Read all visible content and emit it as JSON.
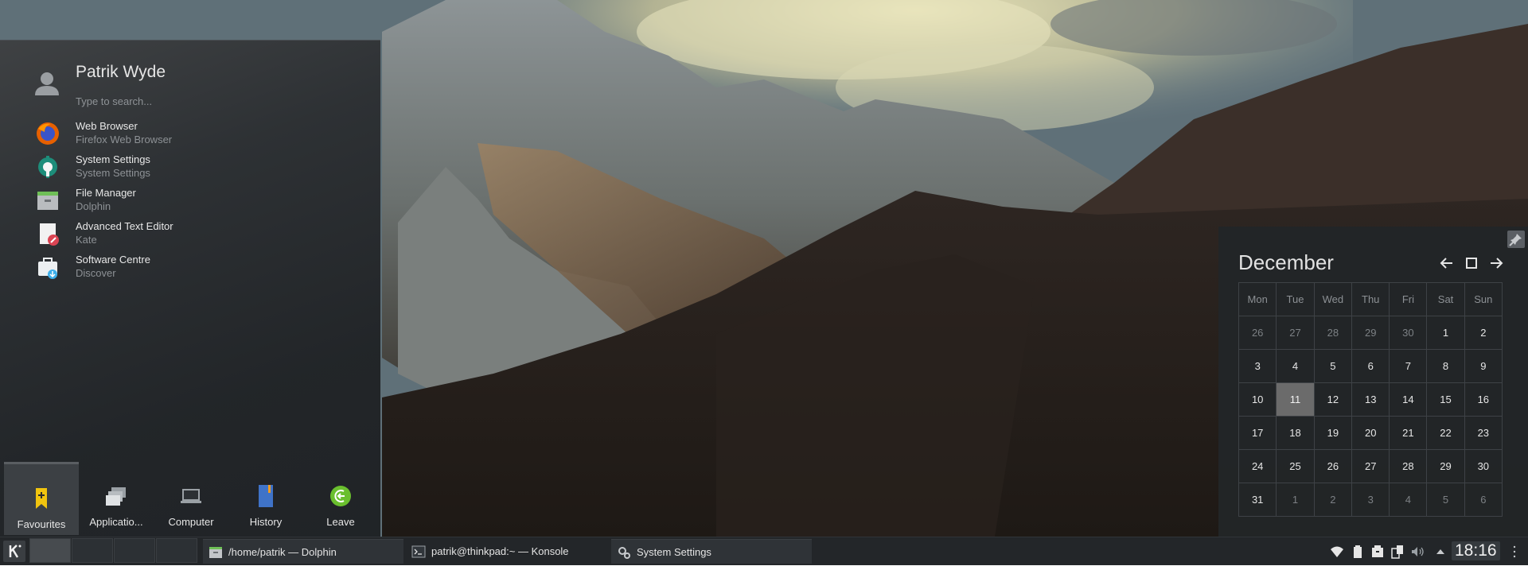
{
  "launcher": {
    "user_name": "Patrik Wyde",
    "search_placeholder": "Type to search...",
    "favourites": [
      {
        "title": "Web Browser",
        "subtitle": "Firefox Web Browser",
        "icon": "firefox-icon"
      },
      {
        "title": "System Settings",
        "subtitle": "System Settings",
        "icon": "settings-icon"
      },
      {
        "title": "File Manager",
        "subtitle": "Dolphin",
        "icon": "folder-icon"
      },
      {
        "title": "Advanced Text Editor",
        "subtitle": "Kate",
        "icon": "text-editor-icon"
      },
      {
        "title": "Software Centre",
        "subtitle": "Discover",
        "icon": "software-centre-icon"
      }
    ],
    "tabs": [
      {
        "label": "Favourites",
        "icon": "bookmark-icon",
        "active": true
      },
      {
        "label": "Applicatio...",
        "icon": "applications-icon"
      },
      {
        "label": "Computer",
        "icon": "computer-icon"
      },
      {
        "label": "History",
        "icon": "history-icon"
      },
      {
        "label": "Leave",
        "icon": "leave-icon"
      }
    ]
  },
  "calendar": {
    "month": "December",
    "weekdays": [
      "Mon",
      "Tue",
      "Wed",
      "Thu",
      "Fri",
      "Sat",
      "Sun"
    ],
    "weeks": [
      [
        "26",
        "27",
        "28",
        "29",
        "30",
        "1",
        "2"
      ],
      [
        "3",
        "4",
        "5",
        "6",
        "7",
        "8",
        "9"
      ],
      [
        "10",
        "11",
        "12",
        "13",
        "14",
        "15",
        "16"
      ],
      [
        "17",
        "18",
        "19",
        "20",
        "21",
        "22",
        "23"
      ],
      [
        "24",
        "25",
        "26",
        "27",
        "28",
        "29",
        "30"
      ],
      [
        "31",
        "1",
        "2",
        "3",
        "4",
        "5",
        "6"
      ]
    ],
    "today": "11",
    "colors": {
      "today_bg": "#6b6b6b",
      "panel_bg": "#222528"
    }
  },
  "taskbar": {
    "tasks": [
      {
        "label": "/home/patrik — Dolphin",
        "icon": "dolphin-icon"
      },
      {
        "label": "patrik@thinkpad:~ — Konsole",
        "icon": "konsole-icon"
      },
      {
        "label": "System Settings",
        "icon": "settings-icon"
      }
    ],
    "tray": [
      "wifi-icon",
      "clipboard-icon",
      "device-notifier-icon",
      "kdeconnect-icon",
      "volume-icon",
      "expand-tray-icon"
    ],
    "clock": "18:16"
  },
  "colors": {
    "accent_leave": "#6abf2e",
    "bookmark_yellow": "#f1c40f"
  }
}
